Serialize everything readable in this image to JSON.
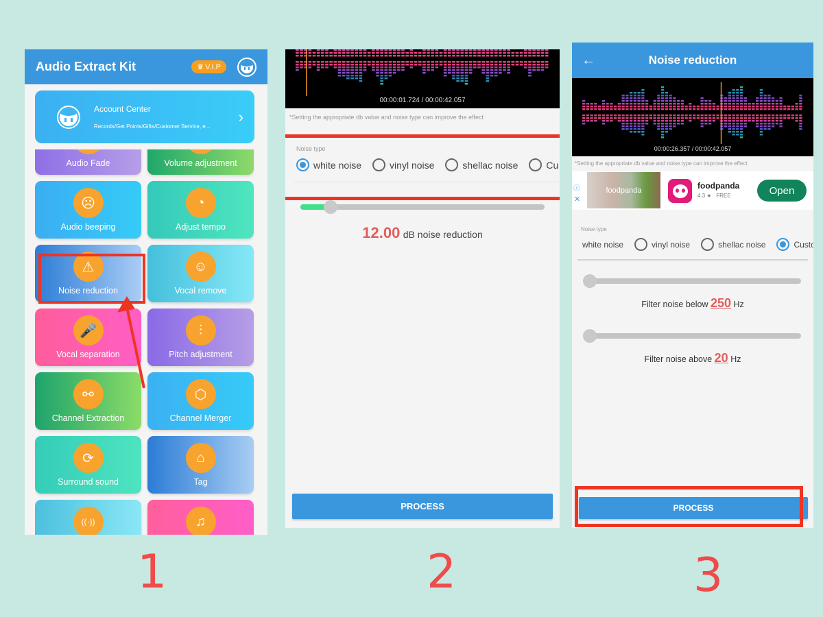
{
  "panel1": {
    "app_title": "Audio Extract Kit",
    "vip_label": "V.I.P",
    "account": {
      "title": "Account Center",
      "subtitle": "Records/Get Points/Gifts/Customer Service, e..."
    },
    "tiles": [
      {
        "label": "Audio Fade",
        "icon": "fade-icon",
        "glyph": "◐",
        "gradient": [
          "#8e6fe6",
          "#b79ee8"
        ]
      },
      {
        "label": "Volume adjustment",
        "icon": "volume-icon",
        "glyph": "◉",
        "gradient": [
          "#1ea86b",
          "#8fd96a"
        ]
      },
      {
        "label": "Audio beeping",
        "icon": "muted-face-icon",
        "glyph": "☹",
        "gradient": [
          "#3aaef2",
          "#36cbf7"
        ]
      },
      {
        "label": "Adjust tempo",
        "icon": "speedometer-icon",
        "glyph": "◔",
        "gradient": [
          "#34c9b9",
          "#4fe6c0"
        ]
      },
      {
        "label": "Noise reduction",
        "icon": "warning-triangle-icon",
        "glyph": "⚠",
        "gradient": [
          "#2c7cd6",
          "#a9cdf5"
        ]
      },
      {
        "label": "Vocal remove",
        "icon": "shush-face-icon",
        "glyph": "☺",
        "gradient": [
          "#45bfdc",
          "#86e8f7"
        ]
      },
      {
        "label": "Vocal separation",
        "icon": "microphone-icon",
        "glyph": "🎤",
        "gradient": [
          "#ff5d9b",
          "#ff5ec6"
        ]
      },
      {
        "label": "Pitch adjustment",
        "icon": "equalizer-icon",
        "glyph": "⫶",
        "gradient": [
          "#8a6ae6",
          "#b69ee6"
        ]
      },
      {
        "label": "Channel Extraction",
        "icon": "split-channel-icon",
        "glyph": "⚯",
        "gradient": [
          "#1da46c",
          "#8bdc67"
        ]
      },
      {
        "label": "Channel Merger",
        "icon": "cube-network-icon",
        "glyph": "⬡",
        "gradient": [
          "#3bb1f2",
          "#36cbf8"
        ]
      },
      {
        "label": "Surround sound",
        "icon": "surround-headphones-icon",
        "glyph": "⟳",
        "gradient": [
          "#34cdb8",
          "#4fe3c0"
        ]
      },
      {
        "label": "Tag",
        "icon": "tag-icon",
        "glyph": "⌂",
        "gradient": [
          "#2c7cd6",
          "#a7cdf3"
        ]
      },
      {
        "label": "",
        "icon": "broadcast-icon",
        "glyph": "((·))",
        "gradient": [
          "#4cc0dd",
          "#8be7f6"
        ]
      },
      {
        "label": "",
        "icon": "microphones-icon",
        "glyph": "♫",
        "gradient": [
          "#ff5f9c",
          "#ff5ec9"
        ]
      }
    ]
  },
  "panel2": {
    "time_display": "00:00:01.724 / 00:00:42.057",
    "hint": "*Setting the appropriate db value and noise type can improve the effect",
    "noise_type_label": "Noise type",
    "noise_options": [
      {
        "label": "white noise",
        "checked": true
      },
      {
        "label": "vinyl noise",
        "checked": false
      },
      {
        "label": "shellac noise",
        "checked": false
      },
      {
        "label": "Cu",
        "checked": false
      }
    ],
    "db_slider_fraction": 0.1,
    "db_value": "12.00",
    "db_suffix": "dB noise reduction",
    "process_label": "PROCESS"
  },
  "panel3": {
    "title": "Noise reduction",
    "back_icon": "←",
    "time_display": "00:00:26.357 / 00:00:42.057",
    "hint": "*Setting the appropriate db value and noise type can improve the effect",
    "ad": {
      "image_text": "foodpanda",
      "app_name": "foodpanda",
      "rating": "4.3 ★",
      "price": "FREE",
      "open_label": "Open",
      "info_icon": "ⓘ",
      "close_icon": "✕"
    },
    "noise_type_label": "Noise type",
    "noise_options": [
      {
        "label": "white noise",
        "checked": false
      },
      {
        "label": "vinyl noise",
        "checked": false
      },
      {
        "label": "shellac noise",
        "checked": false
      },
      {
        "label": "Custom",
        "checked": true
      }
    ],
    "filter_below": {
      "prefix": "Filter noise below",
      "value": "250",
      "unit": "Hz",
      "slider_fraction": 0.0
    },
    "filter_above": {
      "prefix": "Filter noise above",
      "value": "20",
      "unit": "Hz",
      "slider_fraction": 0.0
    },
    "process_label": "PROCESS"
  },
  "steps": [
    "1",
    "2",
    "3"
  ],
  "colors": {
    "background": "#c8e9e2",
    "header_blue": "#3a97dd",
    "annotation_red": "#ee3423",
    "step_red": "#ef4b4b",
    "value_red": "#e35d5d"
  }
}
